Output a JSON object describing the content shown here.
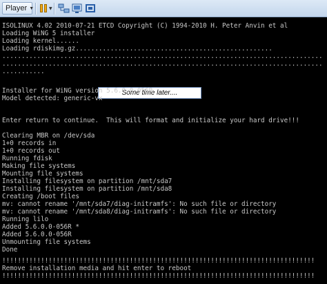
{
  "toolbar": {
    "player_label": "Player",
    "icons": [
      "pause-icon",
      "network-icon",
      "vm-icon",
      "fullscreen-icon"
    ]
  },
  "callout": "Some time later....",
  "console_lines": [
    "ISOLINUX 4.02 2010-07-21 ETCD Copyright (C) 1994-2010 H. Peter Anvin et al",
    "Loading WiNG 5 installer",
    "Loading kernel......",
    "Loading rdiskimg.gz...................................................",
    "...................................................................................",
    "...................................................................................",
    "...........",
    "Installer for WiNG version 5.6.0.0-056R",
    "Model detected: generic-vx",
    "Enter return to continue.  This will format and initialize your hard drive!!!",
    "Clearing MBR on /dev/sda",
    "1+0 records in",
    "1+0 records out",
    "Running fdisk",
    "Making file systems",
    "Mounting file systems",
    "Installing filesystem on partition /mnt/sda7",
    "Installing filesystem on partition /mnt/sda8",
    "Creating /boot files",
    "mv: cannot rename '/mnt/sda7/diag-initramfs': No such file or directory",
    "mv: cannot rename '/mnt/sda8/diag-initramfs': No such file or directory",
    "Running lilo",
    "Added 5.6.0.0-056R *",
    "Added 5.6.0.0-056R",
    "Unmounting file systems",
    "Done",
    "!!!!!!!!!!!!!!!!!!!!!!!!!!!!!!!!!!!!!!!!!!!!!!!!!!!!!!!!!!!!!!!!!!!!!!!!!!!!!!!!!",
    "Remove installation media and hit enter to reboot",
    "!!!!!!!!!!!!!!!!!!!!!!!!!!!!!!!!!!!!!!!!!!!!!!!!!!!!!!!!!!!!!!!!!!!!!!!!!!!!!!!!!"
  ],
  "colors": {
    "console_bg": "#000000",
    "console_text": "#c8c8c8",
    "toolbar_bg": "#c3d6ec"
  }
}
